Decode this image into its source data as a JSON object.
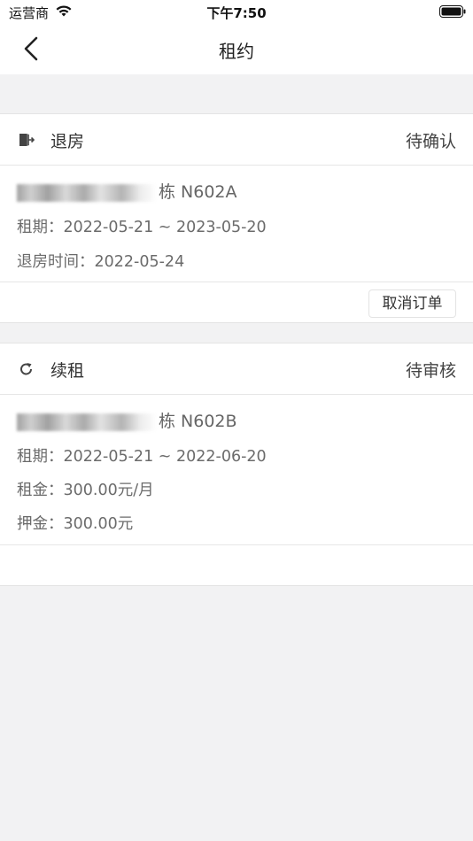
{
  "status_bar": {
    "carrier": "运营商",
    "time": "下午7:50"
  },
  "nav": {
    "title": "租约"
  },
  "cards": [
    {
      "type": "退房",
      "status": "待确认",
      "icon": "checkout-door-icon",
      "address_suffix": "栋 N602A",
      "lines": [
        "租期：2022-05-21 ~ 2023-05-20",
        "退房时间：2022-05-24"
      ],
      "action": "取消订单"
    },
    {
      "type": "续租",
      "status": "待审核",
      "icon": "renew-refresh-icon",
      "address_suffix": "栋 N602B",
      "lines": [
        "租期：2022-05-21 ~ 2022-06-20",
        "租金：300.00元/月",
        "押金：300.00元"
      ]
    }
  ]
}
